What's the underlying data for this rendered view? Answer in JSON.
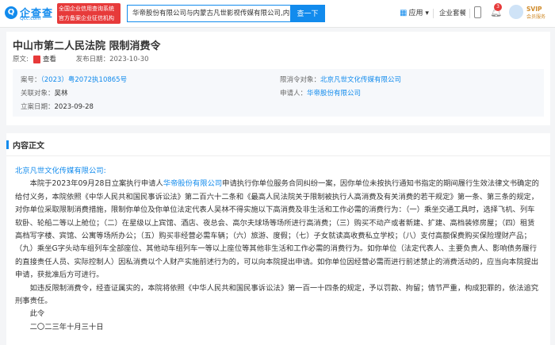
{
  "header": {
    "logo_text": "企查查",
    "logo_sub": "Qcc.com",
    "badge_line1": "全国企业信用查询系统",
    "badge_line2": "官方备案企业征信机构",
    "search_value": "华帝股份有限公司与内蒙古凡世影视传媒有限公司,内蒙...",
    "search_button": "查一下",
    "app_label": "应用",
    "version_label": "企业套餐",
    "bell_count": "3",
    "vip_top": "SVIP",
    "vip_bottom": "会员服务"
  },
  "case": {
    "title": "中山市第二人民法院 限制消费令",
    "source_label": "原文:",
    "view_label": "查看",
    "publish_label": "发布日期：",
    "publish_date": "2023-10-30",
    "case_no_label": "案号：",
    "case_no": "（2023）粤2072执10865号",
    "restricted_label": "限消令对象：",
    "restricted": "北京凡世文化传媒有限公司",
    "related_label": "关联对象：",
    "related": "吴林",
    "applicant_label": "申请人：",
    "applicant": "华帝股份有限公司",
    "filed_label": "立案日期：",
    "filed_date": "2023-09-28"
  },
  "content": {
    "section_title": "内容正文",
    "salutation": "北京凡世文化传媒有限公司:",
    "p1_a": "本院于2023年09月28日立案执行申请人",
    "p1_link": "华帝股份有限公司",
    "p1_b": "申请执行你单位服务合同纠纷一案，因你单位未按执行通知书指定的期间履行生效法律文书确定的给付义务，本院依照《中华人民共和国民事诉讼法》第二百六十二条和《最高人民法院关于限制被执行人高消费及有关消费的若干规定》第一条、第三条的规定，对你单位采取限制消费措施，限制你单位及你单位法定代表人吴林不得实施以下高消费及非生活和工作必需的消费行为：（一）乘坐交通工具时，选择飞机、列车软卧、轮船二等以上舱位；（二）在星级以上宾馆、酒店、夜总会、高尔夫球场等场所进行高消费；（三）购买不动产或者新建、扩建、高档装修房屋；（四）租赁高档写字楼、宾馆、公寓等场所办公；（五）购买非经营必需车辆；（六）旅游、度假；（七）子女就读高收费私立学校；（八）支付高额保费购买保险理财产品；（九）乘坐G字头动车组列车全部座位、其他动车组列车一等以上座位等其他非生活和工作必需的消费行为。如你单位（法定代表人、主要负责人、影响债务履行的直接责任人员、实际控制人）因私消费以个人财产实施前述行为的，可以向本院提出申请。如你单位因经营必需而进行前述禁止的消费活动的，应当向本院提出申请，获批准后方可进行。",
    "p2": "如违反限制消费令，经查证属实的，本院将依照《中华人民共和国民事诉讼法》第一百一十四条的规定，予以罚款、拘留；情节严重，构成犯罪的，依法追究刑事责任。",
    "p3": "此令",
    "p4": "二〇二三年十月三十日"
  }
}
